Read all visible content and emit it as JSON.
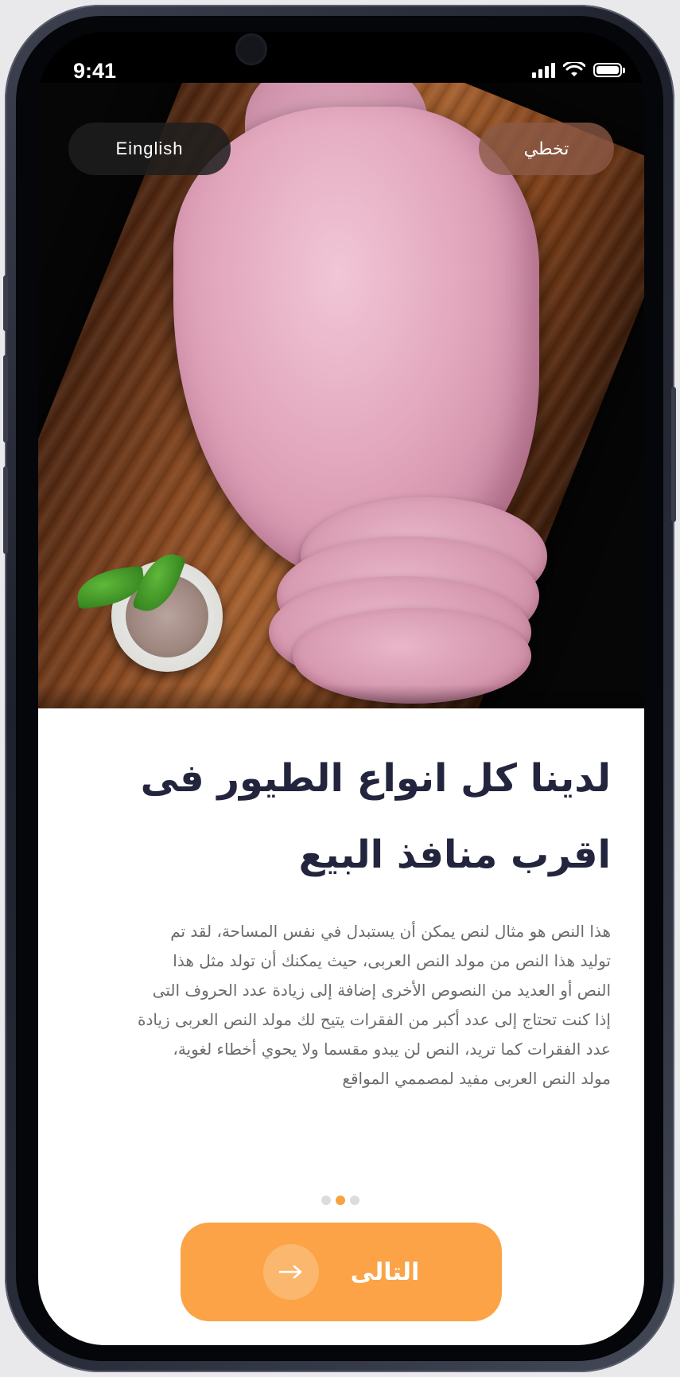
{
  "status_bar": {
    "time": "9:41"
  },
  "top_buttons": {
    "language_label": "Einglish",
    "skip_label": "تخطي"
  },
  "onboarding": {
    "title_line1": "لدينا كل انواع الطيور فى",
    "title_line2": "اقرب منافذ البيع",
    "description_lines": [
      "هذا النص هو مثال لنص يمكن أن يستبدل في نفس المساحة، لقد تم",
      "توليد هذا النص من مولد النص العربى، حيث يمكنك أن تولد مثل هذا",
      "النص أو العديد من النصوص الأخرى إضافة إلى زيادة عدد الحروف التى",
      "إذا كنت تحتاج إلى عدد أكبر من الفقرات يتيح لك مولد النص العربى زيادة",
      "عدد الفقرات كما تريد، النص لن يبدو مقسما ولا يحوي أخطاء لغوية،",
      "مولد النص العربى مفيد لمصممي المواقع"
    ],
    "page_indicator": {
      "total": 3,
      "active_index": 1
    },
    "next_button": {
      "label": "التالى",
      "icon": "arrow-right-icon"
    }
  },
  "colors": {
    "accent": "#fba346",
    "title": "#22253d",
    "body": "#6b6b6b",
    "dot_active": "#f7a243"
  }
}
